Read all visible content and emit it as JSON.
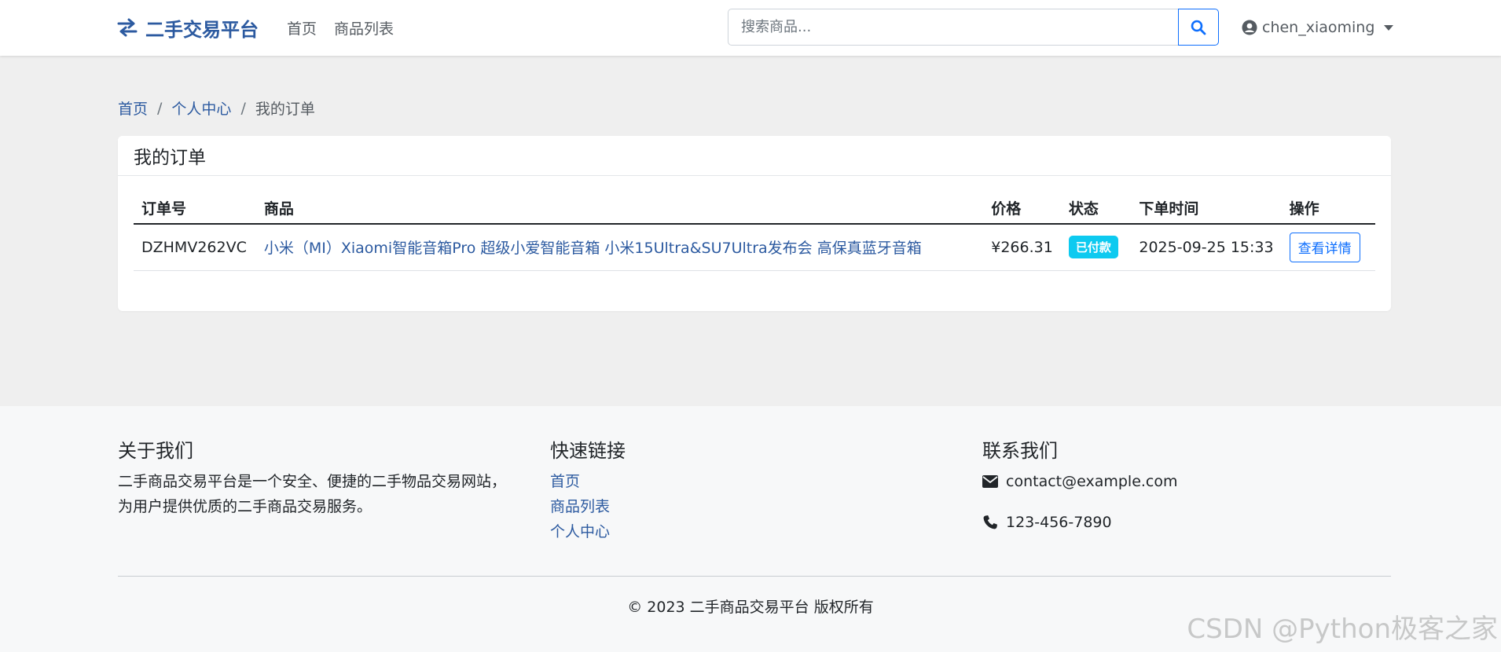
{
  "navbar": {
    "brand": "二手交易平台",
    "brand_icon": "exchange-arrows-icon",
    "links": [
      "首页",
      "商品列表"
    ],
    "search_placeholder": "搜索商品...",
    "search_icon": "search-icon",
    "username": "chen_xiaoming",
    "user_icon": "user-circle-icon"
  },
  "breadcrumb": {
    "items": [
      "首页",
      "个人中心"
    ],
    "current": "我的订单"
  },
  "orders": {
    "title": "我的订单",
    "columns": [
      "订单号",
      "商品",
      "价格",
      "状态",
      "下单时间",
      "操作"
    ],
    "rows": [
      {
        "order_no": "DZHMV262VC",
        "product": "小米（MI）Xiaomi智能音箱Pro 超级小爱智能音箱 小米15Ultra&SU7Ultra发布会 高保真蓝牙音箱",
        "price": "¥266.31",
        "status": "已付款",
        "time": "2025-09-25 15:33",
        "action": "查看详情"
      }
    ]
  },
  "footer": {
    "about_title": "关于我们",
    "about_text_line1": "二手商品交易平台是一个安全、便捷的二手物品交易网站，",
    "about_text_line2": "为用户提供优质的二手商品交易服务。",
    "links_title": "快速链接",
    "links": [
      "首页",
      "商品列表",
      "个人中心"
    ],
    "contact_title": "联系我们",
    "email": "contact@example.com",
    "phone": "123-456-7890",
    "copyright": "© 2023 二手商品交易平台 版权所有"
  },
  "watermark": "CSDN @Python极客之家",
  "colors": {
    "brand": "#2c5aa0",
    "primary": "#0d6efd",
    "badge_info": "#0dcaf0"
  }
}
